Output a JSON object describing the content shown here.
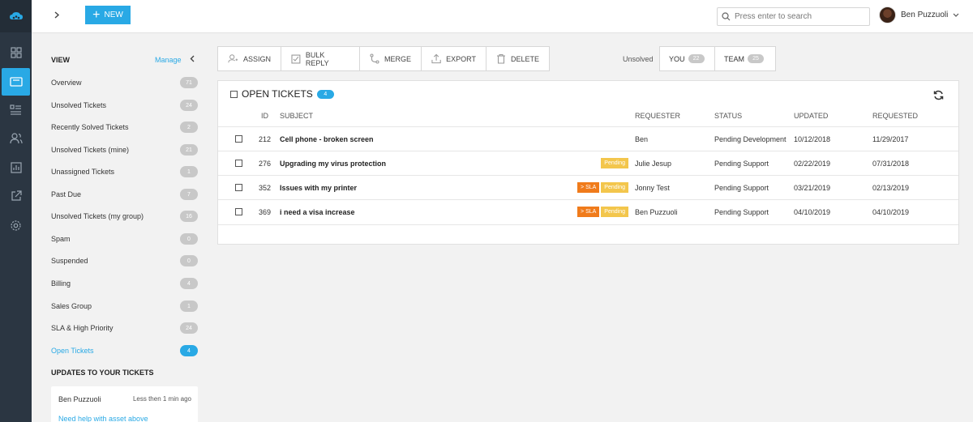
{
  "topbar": {
    "new_label": "NEW",
    "search_placeholder": "Press enter to search",
    "user_name": "Ben Puzzuoli"
  },
  "views": {
    "heading": "VIEW",
    "manage_label": "Manage",
    "items": [
      {
        "label": "Overview",
        "count": "71"
      },
      {
        "label": "Unsolved Tickets",
        "count": "24"
      },
      {
        "label": "Recently Solved Tickets",
        "count": "2"
      },
      {
        "label": "Unsolved Tickets (mine)",
        "count": "21"
      },
      {
        "label": "Unassigned Tickets",
        "count": "1"
      },
      {
        "label": "Past Due",
        "count": "7"
      },
      {
        "label": "Unsolved Tickets (my group)",
        "count": "16"
      },
      {
        "label": "Spam",
        "count": "0"
      },
      {
        "label": "Suspended",
        "count": "0"
      },
      {
        "label": "Billing",
        "count": "4"
      },
      {
        "label": "Sales Group",
        "count": "1"
      },
      {
        "label": "SLA & High Priority",
        "count": "24"
      },
      {
        "label": "Open Tickets",
        "count": "4"
      }
    ],
    "updates_heading": "UPDATES TO YOUR TICKETS",
    "update": {
      "author": "Ben Puzzuoli",
      "time": "Less then 1 min ago",
      "message": "Need help with asset above"
    }
  },
  "toolbar": {
    "assign": "ASSIGN",
    "bulk_reply": "BULK REPLY",
    "merge": "MERGE",
    "export": "EXPORT",
    "delete": "DELETE"
  },
  "filter": {
    "label": "Unsolved",
    "you_label": "YOU",
    "you_count": "22",
    "team_label": "TEAM",
    "team_count": "25"
  },
  "tickets": {
    "title": "OPEN TICKETS",
    "count": "4",
    "columns": {
      "id": "ID",
      "subject": "SUBJECT",
      "requester": "REQUESTER",
      "status": "STATUS",
      "updated": "UPDATED",
      "requested": "REQUESTED"
    },
    "rows": [
      {
        "id": "212",
        "subject": "Cell phone - broken screen",
        "sla": "",
        "pending": "",
        "requester": "Ben",
        "status": "Pending Development",
        "updated": "10/12/2018",
        "requested": "11/29/2017"
      },
      {
        "id": "276",
        "subject": "Upgrading my virus protection",
        "sla": "",
        "pending": "Pending",
        "requester": "Julie Jesup",
        "status": "Pending Support",
        "updated": "02/22/2019",
        "requested": "07/31/2018"
      },
      {
        "id": "352",
        "subject": "Issues with my printer",
        "sla": "> SLA",
        "pending": "Pending",
        "requester": "Jonny Test",
        "status": "Pending Support",
        "updated": "03/21/2019",
        "requested": "02/13/2019"
      },
      {
        "id": "369",
        "subject": "i need a visa increase",
        "sla": "> SLA",
        "pending": "Pending",
        "requester": "Ben Puzzuoli",
        "status": "Pending Support",
        "updated": "04/10/2019",
        "requested": "04/10/2019"
      }
    ]
  },
  "colors": {
    "accent": "#29a9e5",
    "rail": "#2b3642",
    "sla_tag": "#f07b1b",
    "pending_tag": "#f3c64c"
  }
}
